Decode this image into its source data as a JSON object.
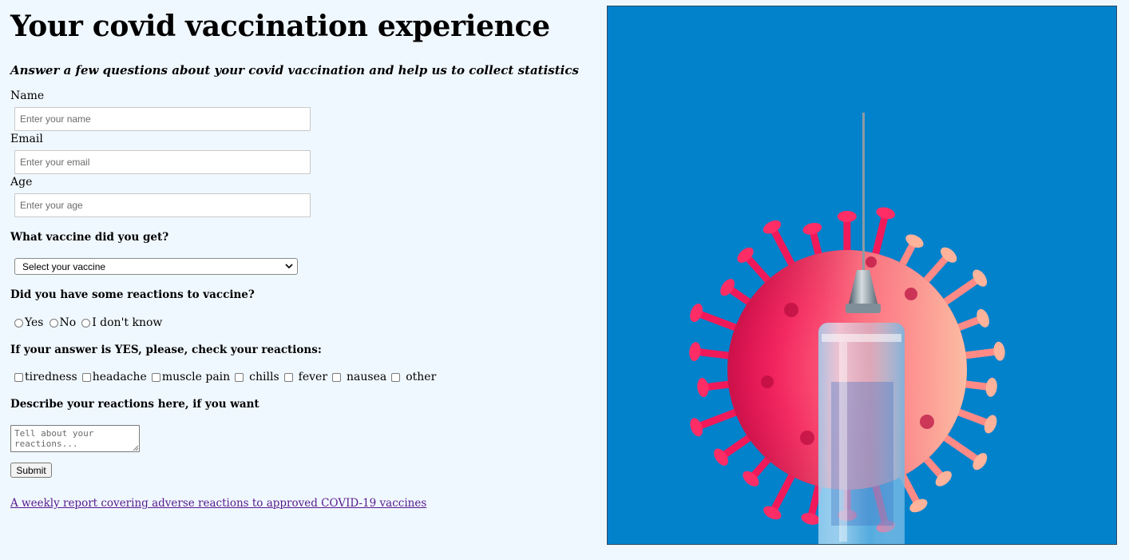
{
  "page": {
    "title": "Your covid vaccination experience",
    "subtitle": "Answer a few questions about your covid vaccination and help us to collect statistics"
  },
  "form": {
    "name": {
      "label": "Name",
      "placeholder": "Enter your name"
    },
    "email": {
      "label": "Email",
      "placeholder": "Enter your email"
    },
    "age": {
      "label": "Age",
      "placeholder": "Enter your age"
    },
    "vaccine": {
      "question": "What vaccine did you get?",
      "selected": "Select your vaccine"
    },
    "reactions": {
      "question": "Did you have some reactions to vaccine?",
      "options": [
        "Yes",
        "No",
        "I don't know"
      ]
    },
    "reaction_list": {
      "question": "If your answer is YES, please, check your reactions:",
      "options": [
        "tiredness",
        "headache",
        "muscle pain",
        "chills",
        "fever",
        "nausea",
        "other"
      ]
    },
    "describe": {
      "question": "Describe your reactions here, if you want",
      "placeholder": "Tell about your reactions..."
    },
    "submit_label": "Submit"
  },
  "link": {
    "text": "A weekly report covering adverse reactions to approved COVID-19 vaccines"
  },
  "colors": {
    "page_bg": "#f0f8ff",
    "hero_bg": "#0382cc",
    "visited_link": "#551a8b",
    "virus_pink": "#f0195a"
  },
  "icons": {
    "select_arrow": "chevron-down-icon",
    "hero": "vaccine-syringe-virus-illustration"
  }
}
